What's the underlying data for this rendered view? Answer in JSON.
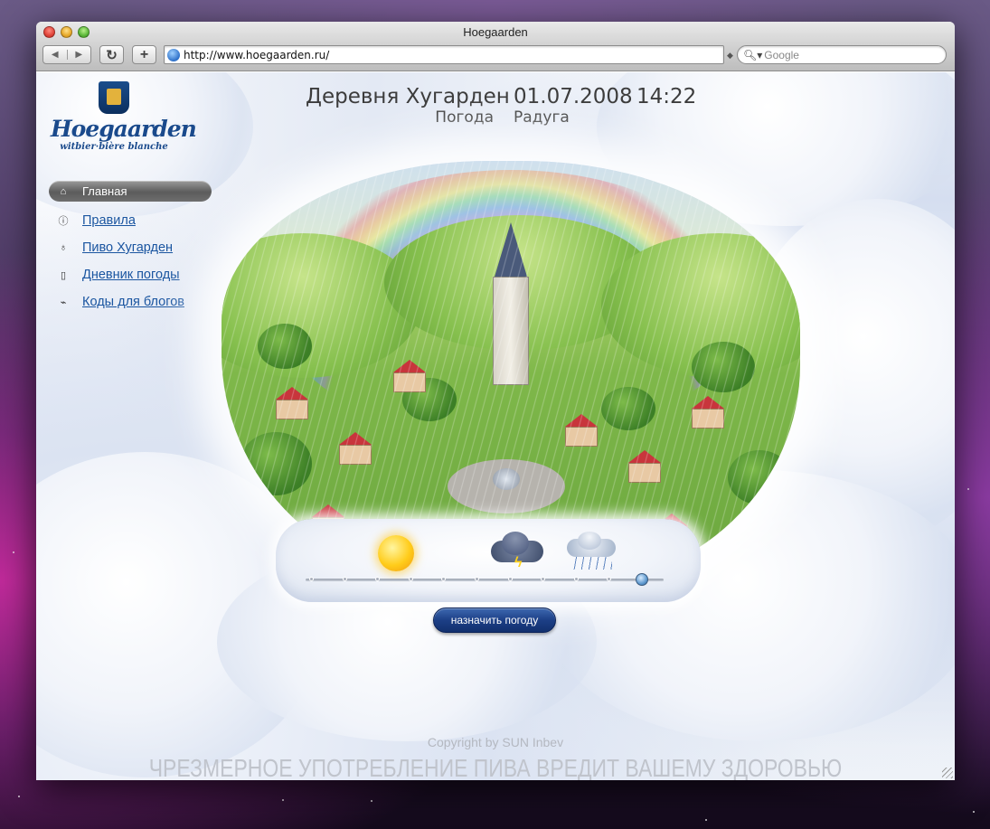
{
  "window": {
    "title": "Hoegaarden"
  },
  "toolbar": {
    "back_icon": "back-arrow-icon",
    "forward_icon": "forward-arrow-icon",
    "reload_glyph": "↻",
    "add_glyph": "+",
    "url": "http://www.hoegaarden.ru/",
    "search_placeholder": "Google"
  },
  "logo": {
    "word": "Hoegaarden",
    "tagline": "witbier·bière blanche"
  },
  "sidebar": {
    "items": [
      {
        "label": "Главная",
        "icon": "home-icon",
        "active": true
      },
      {
        "label": "Правила",
        "icon": "info-icon",
        "active": false
      },
      {
        "label": "Пиво Хугарден",
        "icon": "bottle-icon",
        "active": false
      },
      {
        "label": "Дневник погоды",
        "icon": "notebook-icon",
        "active": false
      },
      {
        "label": "Коды для блогов",
        "icon": "tag-icon",
        "active": false
      }
    ]
  },
  "header": {
    "village": "Деревня Хугарден",
    "date": "01.07.2008",
    "time": "14:22",
    "weather_label": "Погода",
    "weather_value": "Радуга"
  },
  "weather_slider": {
    "icons": [
      "sun-icon",
      "storm-icon",
      "rain-icon"
    ],
    "ticks": 11,
    "selected_index": 10
  },
  "assign_button": {
    "label": "назначить погоду"
  },
  "footer": {
    "copyright": "Copyright by SUN Inbev",
    "warning": "ЧРЕЗМЕРНОЕ УПОТРЕБЛЕНИЕ ПИВА ВРЕДИТ ВАШЕМУ ЗДОРОВЬЮ"
  }
}
